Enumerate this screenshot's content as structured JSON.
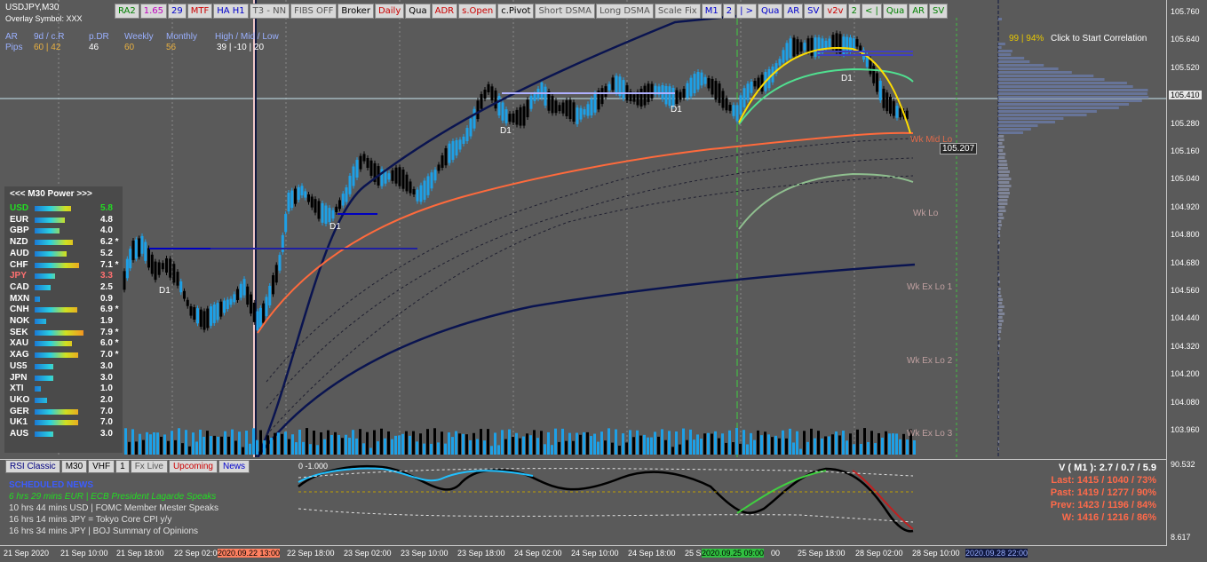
{
  "symbol": {
    "title": "USDJPY,M30",
    "overlay": "Overlay Symbol: XXX"
  },
  "toolbar": [
    {
      "label": "RA2",
      "color": "#008000"
    },
    {
      "label": "1.65",
      "color": "#c000c0"
    },
    {
      "label": "29",
      "color": "#0000cc"
    },
    {
      "label": "MTF",
      "color": "#cc0000"
    },
    {
      "label": "HA H1",
      "color": "#0000cc"
    },
    {
      "label": "T3 - NN",
      "color": "#555555"
    },
    {
      "label": "FIBS OFF",
      "color": "#555555"
    },
    {
      "label": "Broker",
      "color": "#000000"
    },
    {
      "label": "Daily",
      "color": "#cc0000"
    },
    {
      "label": "Qua",
      "color": "#000000"
    },
    {
      "label": "ADR",
      "color": "#cc0000"
    },
    {
      "label": "s.Open",
      "color": "#cc0000"
    },
    {
      "label": "c.Pivot",
      "color": "#000000"
    },
    {
      "label": "Short DSMA",
      "color": "#555555"
    },
    {
      "label": "Long DSMA",
      "color": "#555555"
    },
    {
      "label": "Scale Fix",
      "color": "#555555"
    },
    {
      "label": "M1",
      "color": "#0000cc"
    },
    {
      "label": "2",
      "color": "#0000cc"
    },
    {
      "label": "| >",
      "color": "#0000cc"
    },
    {
      "label": "Qua",
      "color": "#0000cc"
    },
    {
      "label": "AR",
      "color": "#0000cc"
    },
    {
      "label": "SV",
      "color": "#0000cc"
    },
    {
      "label": "v2v",
      "color": "#cc0000"
    },
    {
      "label": "2",
      "color": "#008000"
    },
    {
      "label": "< |",
      "color": "#008000"
    },
    {
      "label": "Qua",
      "color": "#008000"
    },
    {
      "label": "AR",
      "color": "#008000"
    },
    {
      "label": "SV",
      "color": "#008000"
    }
  ],
  "stats": {
    "row1": {
      "ar": "AR",
      "dcr": "9d / c.R",
      "pdr": "p.DR",
      "weekly": "Weekly",
      "monthly": "Monthly",
      "hml": "High / Mid / Low"
    },
    "row2": {
      "pips": "Pips",
      "dcr": "60 | 42",
      "pdr": "46",
      "weekly": "60",
      "monthly": "56",
      "hml": "39  |  -10  |  20"
    }
  },
  "correlation": {
    "pct": "99 | 94%",
    "label": "Click to Start Correlation"
  },
  "power": {
    "header": "<<<  M30   Power  >>>",
    "rows": [
      {
        "name": "USD",
        "value": "5.8",
        "color": "#22dd22",
        "fill": 0.58
      },
      {
        "name": "EUR",
        "value": "4.8",
        "color": "#ffffff",
        "fill": 0.48
      },
      {
        "name": "GBP",
        "value": "4.0",
        "color": "#ffffff",
        "fill": 0.4
      },
      {
        "name": "NZD",
        "value": "6.2 *",
        "color": "#ffffff",
        "fill": 0.62
      },
      {
        "name": "AUD",
        "value": "5.2",
        "color": "#ffffff",
        "fill": 0.52
      },
      {
        "name": "CHF",
        "value": "7.1 *",
        "color": "#ffffff",
        "fill": 0.71
      },
      {
        "name": "JPY",
        "value": "3.3",
        "color": "#ff7070",
        "fill": 0.33
      },
      {
        "name": "CAD",
        "value": "2.5",
        "color": "#ffffff",
        "fill": 0.25
      },
      {
        "name": "MXN",
        "value": "0.9",
        "color": "#ffffff",
        "fill": 0.09
      },
      {
        "name": "CNH",
        "value": "6.9 *",
        "color": "#ffffff",
        "fill": 0.69
      },
      {
        "name": "NOK",
        "value": "1.9",
        "color": "#ffffff",
        "fill": 0.19
      },
      {
        "name": "SEK",
        "value": "7.9 *",
        "color": "#ffffff",
        "fill": 0.79
      },
      {
        "name": "XAU",
        "value": "6.0 *",
        "color": "#ffffff",
        "fill": 0.6
      },
      {
        "name": "XAG",
        "value": "7.0 *",
        "color": "#ffffff",
        "fill": 0.7
      },
      {
        "name": "US5",
        "value": "3.0",
        "color": "#ffffff",
        "fill": 0.3
      },
      {
        "name": "JPN",
        "value": "3.0",
        "color": "#ffffff",
        "fill": 0.3
      },
      {
        "name": "XTI",
        "value": "1.0",
        "color": "#ffffff",
        "fill": 0.1
      },
      {
        "name": "UKO",
        "value": "2.0",
        "color": "#ffffff",
        "fill": 0.2
      },
      {
        "name": "GER",
        "value": "7.0",
        "color": "#ffffff",
        "fill": 0.7
      },
      {
        "name": "UK1",
        "value": "7.0",
        "color": "#ffffff",
        "fill": 0.7
      },
      {
        "name": "AUS",
        "value": "3.0",
        "color": "#ffffff",
        "fill": 0.3
      }
    ]
  },
  "bottom_tabs": [
    {
      "label": "RSI Classic",
      "color": "#000080"
    },
    {
      "label": "M30",
      "color": "#000000"
    },
    {
      "label": "VHF",
      "color": "#000000"
    },
    {
      "label": "1",
      "color": "#000000"
    },
    {
      "label": "Fx Live",
      "color": "#555555"
    },
    {
      "label": "Upcoming",
      "color": "#cc0000"
    },
    {
      "label": "News",
      "color": "#0000cc"
    }
  ],
  "news": {
    "title": "SCHEDULED NEWS",
    "items": [
      {
        "text": "6 hrs 29 mins  EUR  |  ECB President Lagarde Speaks",
        "color": "#22dd22"
      },
      {
        "text": "10 hrs 44 mins  USD  |  FOMC Member Mester Speaks",
        "color": "#e0e0e0"
      },
      {
        "text": "16 hrs 14 mins  JPY  =  Tokyo Core CPI y/y",
        "color": "#e0e0e0"
      },
      {
        "text": "16 hrs 34 mins  JPY  |  BOJ Summary of Opinions",
        "color": "#e0e0e0"
      }
    ]
  },
  "osc_label": "0 -1.000",
  "volatility": {
    "header": "V ( M1 ): 2.7 / 0.7 / 5.9",
    "last": "Last: 1415 / 1040 / 73%",
    "past": "Past: 1419 / 1277 / 90%",
    "prev": "Prev: 1423 / 1196 / 84%",
    "w": "W: 1416 / 1216 / 86%"
  },
  "levels": {
    "wk_mid_lo": "Wk Mid Lo",
    "wk_lo": "Wk Lo",
    "wk_ex_lo_1": "Wk Ex Lo 1",
    "wk_ex_lo_2": "Wk Ex Lo 2",
    "wk_ex_lo_3": "Wk Ex Lo 3",
    "price_box": "105.207",
    "d1_label": "D1"
  },
  "price_axis": [
    "105.760",
    "105.640",
    "105.520",
    "105.410",
    "105.280",
    "105.160",
    "105.040",
    "104.920",
    "104.800",
    "104.680",
    "104.560",
    "104.440",
    "104.320",
    "104.200",
    "104.080",
    "103.960"
  ],
  "osc_axis": {
    "top": "90.532",
    "bottom": "8.617"
  },
  "time_axis": [
    "21 Sep 2020",
    "21 Sep 10:00",
    "21 Sep 18:00",
    "22 Sep 02:00",
    "2020.09.22 13:00",
    "22 Sep 18:00",
    "23 Sep 02:00",
    "23 Sep 10:00",
    "23 Sep 18:00",
    "24 Sep 02:00",
    "24 Sep 10:00",
    "24 Sep 18:00",
    "25 S",
    "2020.09.25 09:00",
    "00",
    "25 Sep 18:00",
    "28 Sep 02:00",
    "28 Sep 10:00",
    "2020.09.28 22:00"
  ],
  "colors": {
    "bg": "#5a5a5a",
    "bull": "#1ea0e6",
    "bear": "#000000",
    "ma_navy": "#0a1450",
    "ma_orange": "#ff6a3c",
    "ma_green": "#8fbf8f",
    "parab": "#ffdd00"
  }
}
